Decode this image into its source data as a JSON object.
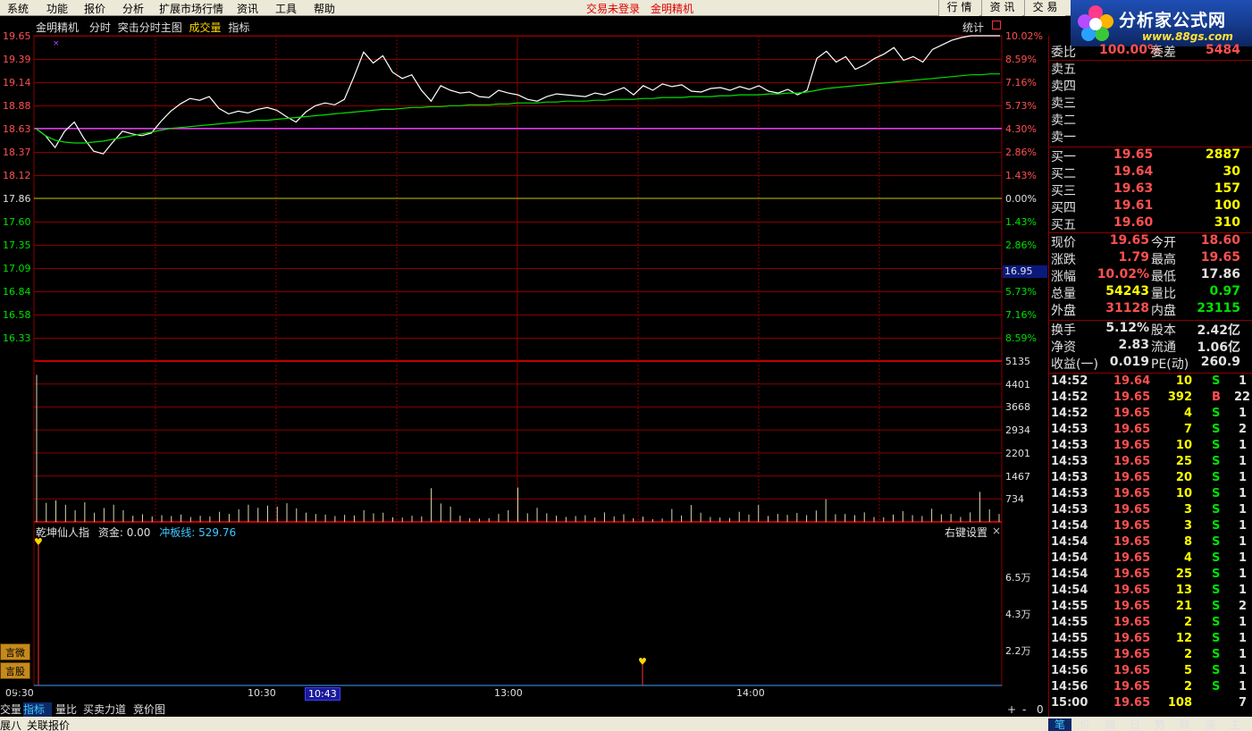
{
  "menu": {
    "items": [
      "系统",
      "功能",
      "报价",
      "分析",
      "扩展市场行情",
      "资讯",
      "工具",
      "帮助"
    ],
    "status_login": "交易未登录",
    "status_stock": "金明精机",
    "right_buttons": [
      "行 情",
      "资 讯",
      "交 易"
    ]
  },
  "logo": {
    "title": "分析家公式网",
    "url": "www.88gs.com"
  },
  "chart_header": {
    "stock": "金明精机",
    "mode": "分时",
    "main": "突击分时主图",
    "vol": "成交量",
    "indicator": "指标",
    "stats_button": "统计"
  },
  "axes": {
    "left_prices": [
      "19.65",
      "19.39",
      "19.14",
      "18.88",
      "18.63",
      "18.37",
      "18.12",
      "17.86",
      "17.60",
      "17.35",
      "17.09",
      "16.84",
      "16.58",
      "16.33"
    ],
    "right_pcts": [
      "10.02%",
      "8.59%",
      "7.16%",
      "5.73%",
      "4.30%",
      "2.86%",
      "1.43%",
      "0.00%",
      "1.43%",
      "2.86%",
      "",
      "5.73%",
      "7.16%",
      "8.59%"
    ],
    "cursor_value": "16.95",
    "vol_labels": [
      "5135",
      "4401",
      "3668",
      "2934",
      "2201",
      "1467",
      "734"
    ],
    "ind_labels": [
      "6.5万",
      "4.3万",
      "2.2万"
    ],
    "time_labels": [
      "09:30",
      "10:30",
      "10:43",
      "13:00",
      "14:00"
    ]
  },
  "colors": {
    "up": "#ff5050",
    "down": "#00e000",
    "grid": "#8a0000",
    "price_line": "#ffffff",
    "avg_line": "#00e000",
    "ref_line": "#c8c800"
  },
  "indicator": {
    "name": "乾坤仙人指",
    "fund_label": "资金:",
    "fund_value": "0.00",
    "line_label": "冲板线:",
    "line_value": "529.76",
    "settings": "右键设置",
    "close": "×"
  },
  "side_buttons": [
    "言微信",
    "言股搜"
  ],
  "order_book": {
    "weibi_label": "委比",
    "weibi_value": "100.00%",
    "weicha_label": "委差",
    "weicha_value": "5484",
    "asks": [
      {
        "label": "卖五"
      },
      {
        "label": "卖四"
      },
      {
        "label": "卖三"
      },
      {
        "label": "卖二"
      },
      {
        "label": "卖一"
      }
    ],
    "bids": [
      {
        "label": "买一",
        "price": "19.65",
        "vol": "2887"
      },
      {
        "label": "买二",
        "price": "19.64",
        "vol": "30"
      },
      {
        "label": "买三",
        "price": "19.63",
        "vol": "157"
      },
      {
        "label": "买四",
        "price": "19.61",
        "vol": "100"
      },
      {
        "label": "买五",
        "price": "19.60",
        "vol": "310"
      }
    ]
  },
  "quote_stats": [
    {
      "l1": "现价",
      "v1": "19.65",
      "c1": "#ff5050",
      "l2": "今开",
      "v2": "18.60",
      "c2": "#ff5050"
    },
    {
      "l1": "涨跌",
      "v1": "1.79",
      "c1": "#ff5050",
      "l2": "最高",
      "v2": "19.65",
      "c2": "#ff5050"
    },
    {
      "l1": "涨幅",
      "v1": "10.02%",
      "c1": "#ff5050",
      "l2": "最低",
      "v2": "17.86",
      "c2": "#e0e0e0"
    },
    {
      "l1": "总量",
      "v1": "54243",
      "c1": "#ffff00",
      "l2": "量比",
      "v2": "0.97",
      "c2": "#00e000"
    },
    {
      "l1": "外盘",
      "v1": "31128",
      "c1": "#ff5050",
      "l2": "内盘",
      "v2": "23115",
      "c2": "#00e000"
    }
  ],
  "fundamentals": [
    {
      "l1": "换手",
      "v1": "5.12%",
      "l2": "股本",
      "v2": "2.42亿"
    },
    {
      "l1": "净资",
      "v1": "2.83",
      "l2": "流通",
      "v2": "1.06亿"
    },
    {
      "l1": "收益(一)",
      "v1": "0.019",
      "l2": "PE(动)",
      "v2": "260.9"
    }
  ],
  "ticks": [
    {
      "time": "14:52",
      "price": "19.64",
      "vol": "10",
      "side": "S",
      "num": "1"
    },
    {
      "time": "14:52",
      "price": "19.65",
      "vol": "392",
      "side": "B",
      "num": "22"
    },
    {
      "time": "14:52",
      "price": "19.65",
      "vol": "4",
      "side": "S",
      "num": "1"
    },
    {
      "time": "14:53",
      "price": "19.65",
      "vol": "7",
      "side": "S",
      "num": "2"
    },
    {
      "time": "14:53",
      "price": "19.65",
      "vol": "10",
      "side": "S",
      "num": "1"
    },
    {
      "time": "14:53",
      "price": "19.65",
      "vol": "25",
      "side": "S",
      "num": "1"
    },
    {
      "time": "14:53",
      "price": "19.65",
      "vol": "20",
      "side": "S",
      "num": "1"
    },
    {
      "time": "14:53",
      "price": "19.65",
      "vol": "10",
      "side": "S",
      "num": "1"
    },
    {
      "time": "14:53",
      "price": "19.65",
      "vol": "3",
      "side": "S",
      "num": "1"
    },
    {
      "time": "14:54",
      "price": "19.65",
      "vol": "3",
      "side": "S",
      "num": "1"
    },
    {
      "time": "14:54",
      "price": "19.65",
      "vol": "8",
      "side": "S",
      "num": "1"
    },
    {
      "time": "14:54",
      "price": "19.65",
      "vol": "4",
      "side": "S",
      "num": "1"
    },
    {
      "time": "14:54",
      "price": "19.65",
      "vol": "25",
      "side": "S",
      "num": "1"
    },
    {
      "time": "14:54",
      "price": "19.65",
      "vol": "13",
      "side": "S",
      "num": "1"
    },
    {
      "time": "14:55",
      "price": "19.65",
      "vol": "21",
      "side": "S",
      "num": "2"
    },
    {
      "time": "14:55",
      "price": "19.65",
      "vol": "2",
      "side": "S",
      "num": "1"
    },
    {
      "time": "14:55",
      "price": "19.65",
      "vol": "12",
      "side": "S",
      "num": "1"
    },
    {
      "time": "14:55",
      "price": "19.65",
      "vol": "2",
      "side": "S",
      "num": "1"
    },
    {
      "time": "14:56",
      "price": "19.65",
      "vol": "5",
      "side": "S",
      "num": "1"
    },
    {
      "time": "14:56",
      "price": "19.65",
      "vol": "2",
      "side": "S",
      "num": "1"
    },
    {
      "time": "15:00",
      "price": "19.65",
      "vol": "108",
      "side": "",
      "num": "7"
    }
  ],
  "bottom_tabs": [
    "交量",
    "指标",
    "量比",
    "买卖力道",
    "竞价图"
  ],
  "bottom_status": [
    "展八",
    "关联报价"
  ],
  "zoom_controls": [
    "+",
    "-",
    "0"
  ],
  "right_tabs": [
    "笔",
    "价",
    "细",
    "日",
    "势",
    "联",
    "值",
    "主"
  ],
  "chart_data": {
    "type": "line",
    "series": [
      {
        "values": [
          18.63,
          18.55,
          18.42,
          18.6,
          18.7,
          18.52,
          18.38,
          18.35,
          18.48,
          18.6,
          18.57,
          18.55,
          18.58,
          18.71,
          18.82,
          18.9,
          18.96,
          18.94,
          18.98,
          18.85,
          18.79,
          18.82,
          18.8,
          18.84,
          18.86,
          18.83,
          18.76,
          18.7,
          18.81,
          18.88,
          18.91,
          18.89,
          18.95,
          19.2,
          19.47,
          19.35,
          19.43,
          19.25,
          19.18,
          19.22,
          19.05,
          18.93,
          19.1,
          19.05,
          19.02,
          19.03,
          18.98,
          18.97,
          19.05,
          19.02,
          19.0,
          18.95,
          18.93,
          18.98,
          19.01,
          19.0,
          18.99,
          18.98,
          19.02,
          19.0,
          19.04,
          19.08,
          19.0,
          19.1,
          19.05,
          19.12,
          19.09,
          19.11,
          19.04,
          19.03,
          19.07,
          19.08,
          19.05,
          19.09,
          19.06,
          19.1,
          19.04,
          19.02,
          19.06,
          19.0,
          19.05,
          19.4,
          19.48,
          19.36,
          19.42,
          19.28,
          19.33,
          19.4,
          19.45,
          19.52,
          19.38,
          19.42,
          19.36,
          19.5,
          19.55,
          19.6,
          19.63,
          19.65,
          19.65,
          19.65,
          19.65
        ]
      },
      {
        "values": [
          18.63,
          18.55,
          18.5,
          18.48,
          18.47,
          18.47,
          18.48,
          18.49,
          18.51,
          18.53,
          18.55,
          18.57,
          18.59,
          18.61,
          18.63,
          18.64,
          18.65,
          18.66,
          18.67,
          18.68,
          18.69,
          18.7,
          18.71,
          18.72,
          18.72,
          18.73,
          18.74,
          18.75,
          18.76,
          18.77,
          18.78,
          18.79,
          18.8,
          18.81,
          18.82,
          18.83,
          18.84,
          18.84,
          18.85,
          18.86,
          18.86,
          18.87,
          18.87,
          18.88,
          18.88,
          18.89,
          18.89,
          18.89,
          18.9,
          18.9,
          18.91,
          18.91,
          18.91,
          18.92,
          18.92,
          18.93,
          18.93,
          18.93,
          18.94,
          18.94,
          18.95,
          18.95,
          18.95,
          18.96,
          18.96,
          18.97,
          18.97,
          18.97,
          18.98,
          18.98,
          18.98,
          18.99,
          18.99,
          19.0,
          19.0,
          19.0,
          19.01,
          19.01,
          19.02,
          19.02,
          19.03,
          19.05,
          19.07,
          19.08,
          19.09,
          19.1,
          19.11,
          19.12,
          19.13,
          19.14,
          19.15,
          19.16,
          19.17,
          19.18,
          19.19,
          19.2,
          19.21,
          19.22,
          19.22,
          19.23,
          19.23
        ]
      }
    ],
    "ref_price": 17.86,
    "ylim": [
      16.07,
      19.65
    ],
    "volumes": [
      4800,
      620,
      700,
      560,
      380,
      640,
      300,
      450,
      560,
      380,
      200,
      250,
      180,
      220,
      190,
      240,
      160,
      200,
      180,
      330,
      260,
      410,
      560,
      460,
      530,
      500,
      610,
      440,
      300,
      260,
      240,
      190,
      230,
      210,
      380,
      280,
      300,
      150,
      140,
      200,
      180,
      1100,
      600,
      500,
      200,
      120,
      110,
      120,
      260,
      380,
      1120,
      280,
      460,
      280,
      200,
      160,
      190,
      220,
      140,
      310,
      180,
      250,
      120,
      170,
      90,
      110,
      420,
      210,
      550,
      300,
      160,
      140,
      130,
      330,
      240,
      550,
      190,
      260,
      230,
      290,
      220,
      370,
      740,
      250,
      260,
      220,
      310,
      160,
      150,
      240,
      350,
      220,
      190,
      430,
      250,
      260,
      160,
      310,
      980,
      410,
      260
    ],
    "vol_ylim": [
      0,
      5135
    ]
  }
}
